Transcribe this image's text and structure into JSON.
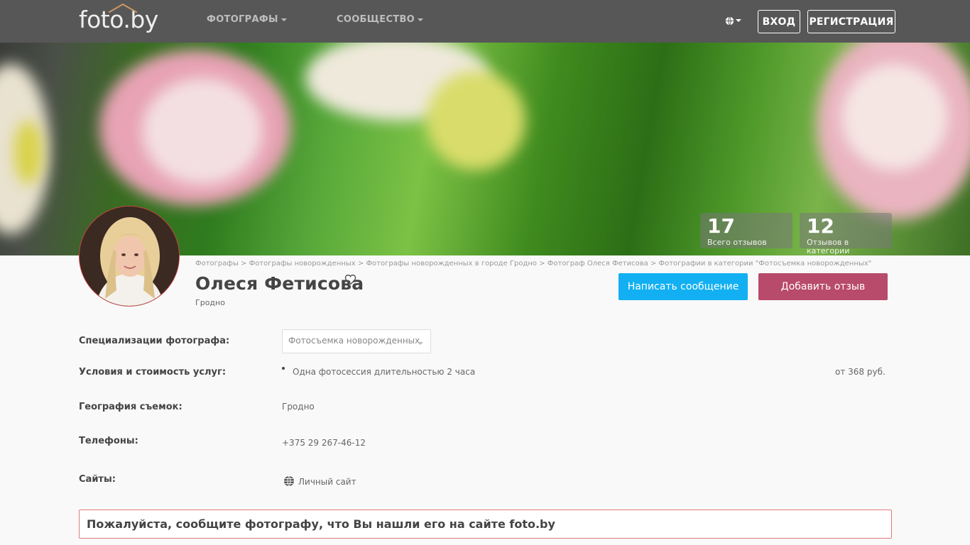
{
  "nav": {
    "logo": "foto.by",
    "menu": [
      {
        "label": "ФОТОГРАФЫ"
      },
      {
        "label": "СООБЩЕСТВО"
      }
    ],
    "login": "ВХОД",
    "register": "РЕГИСТРАЦИЯ"
  },
  "stats": [
    {
      "value": "17",
      "label": "Всего отзывов"
    },
    {
      "value": "12",
      "label": "Отзывов в категории"
    }
  ],
  "breadcrumb": "Фотографы > Фотографы новорожденных > Фотографы новорожденных в городе Гродно > Фотограф Олеся Фетисова > Фотографии в категории \"Фотосъемка новорожденных\"",
  "profile": {
    "name": "Олеся Фетисова",
    "city": "Гродно",
    "message_button": "Написать сообщение",
    "review_button": "Добавить отзыв"
  },
  "info": {
    "specialization_label": "Специализации фотографа:",
    "specialization_value": "Фотосъемка новорожденных",
    "conditions_label": "Условия и стоимость услуг:",
    "conditions_item": "Одна фотосессия длительностью 2 часа",
    "conditions_price": "от 368 руб.",
    "geography_label": "География съемок:",
    "geography_value": "Гродно",
    "phones_label": "Телефоны:",
    "phones_value": "+375 29 267-46-12",
    "sites_label": "Сайты:",
    "sites_value": "Личный сайт"
  },
  "notice": "Пожалуйста, сообщите фотографу, что Вы нашли его на сайте foto.by",
  "colors": {
    "navbar": "#575757",
    "primary_button": "#12b0f2",
    "review_button": "#b84a6b",
    "notice_border": "#e07a7a"
  }
}
